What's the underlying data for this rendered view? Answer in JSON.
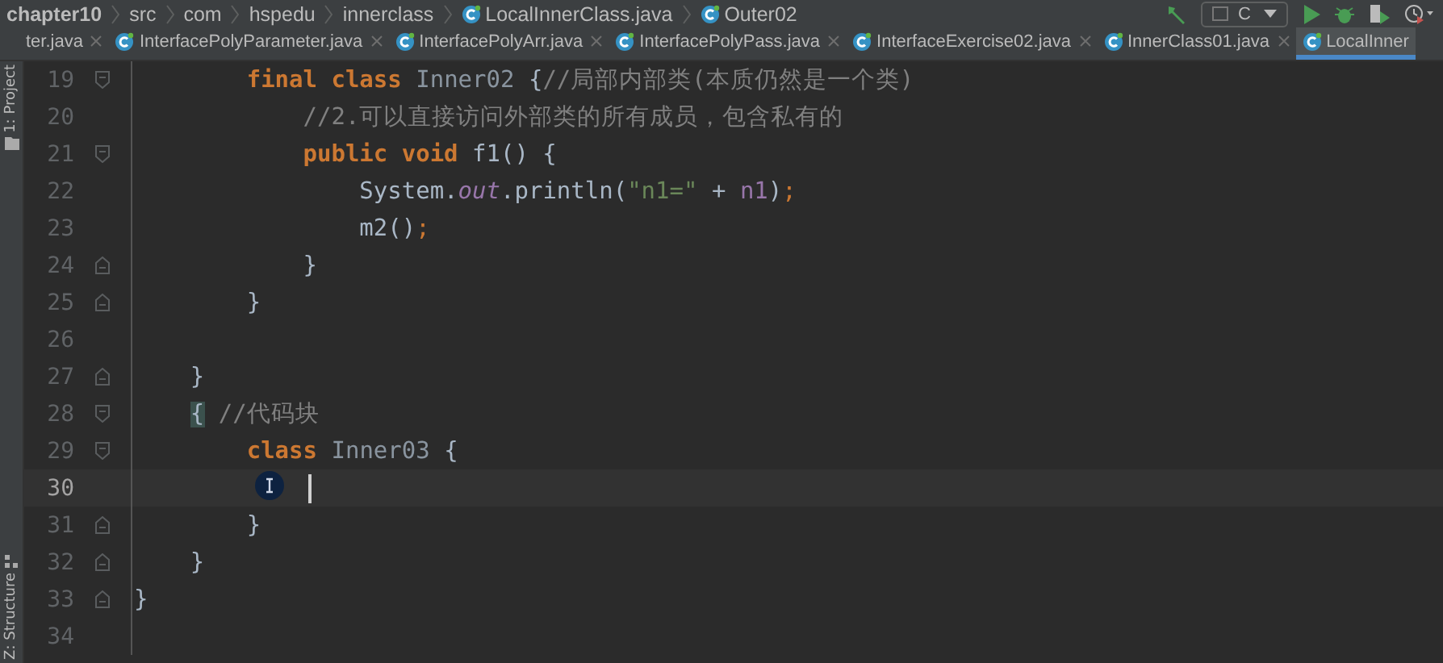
{
  "breadcrumbs": [
    {
      "label": "chapter10",
      "kind": "project"
    },
    {
      "label": "src",
      "kind": "folder"
    },
    {
      "label": "com",
      "kind": "folder"
    },
    {
      "label": "hspedu",
      "kind": "folder"
    },
    {
      "label": "innerclass",
      "kind": "folder"
    },
    {
      "label": "LocalInnerClass.java",
      "kind": "class"
    },
    {
      "label": "Outer02",
      "kind": "class"
    }
  ],
  "toolbar": {
    "config": "C"
  },
  "tabs": [
    {
      "label": "ter.java",
      "selected": false
    },
    {
      "label": "InterfacePolyParameter.java",
      "selected": false
    },
    {
      "label": "InterfacePolyArr.java",
      "selected": false
    },
    {
      "label": "InterfacePolyPass.java",
      "selected": false
    },
    {
      "label": "InterfaceExercise02.java",
      "selected": false
    },
    {
      "label": "InnerClass01.java",
      "selected": false
    },
    {
      "label": "LocalInner",
      "selected": true
    }
  ],
  "side_tools": [
    {
      "label": "1: Project",
      "kind": "project"
    },
    {
      "label": "Z: Structure",
      "kind": "structure"
    }
  ],
  "lines": [
    {
      "number": "19",
      "kind": "fold-start",
      "current": false,
      "tokens": [
        {
          "kind": "keyword",
          "text": "        final class"
        },
        {
          "kind": "unused",
          "text": " Inner02 "
        },
        {
          "kind": "text",
          "text": "{"
        },
        {
          "kind": "comment",
          "text": "//局部内部类(本质仍然是一个类)"
        }
      ]
    },
    {
      "number": "20",
      "kind": "plain",
      "current": false,
      "tokens": [
        {
          "kind": "comment",
          "text": "            //2.可以直接访问外部类的所有成员，包含私有的"
        }
      ]
    },
    {
      "number": "21",
      "kind": "fold-start",
      "current": false,
      "tokens": [
        {
          "kind": "keyword",
          "text": "            public void"
        },
        {
          "kind": "text",
          "text": " f1() {"
        }
      ]
    },
    {
      "number": "22",
      "kind": "plain",
      "current": false,
      "tokens": [
        {
          "kind": "text",
          "text": "                System."
        },
        {
          "kind": "static",
          "text": "out"
        },
        {
          "kind": "text",
          "text": ".println("
        },
        {
          "kind": "string",
          "text": "\"n1=\""
        },
        {
          "kind": "text",
          "text": " + "
        },
        {
          "kind": "field",
          "text": "n1"
        },
        {
          "kind": "text",
          "text": ")"
        },
        {
          "kind": "punct",
          "text": ";"
        }
      ]
    },
    {
      "number": "23",
      "kind": "plain",
      "current": false,
      "tokens": [
        {
          "kind": "text",
          "text": "                m2()"
        },
        {
          "kind": "punct",
          "text": ";"
        }
      ]
    },
    {
      "number": "24",
      "kind": "fold-end",
      "current": false,
      "tokens": [
        {
          "kind": "text",
          "text": "            }"
        }
      ]
    },
    {
      "number": "25",
      "kind": "fold-end",
      "current": false,
      "tokens": [
        {
          "kind": "text",
          "text": "        }"
        }
      ]
    },
    {
      "number": "26",
      "kind": "plain",
      "current": false
    },
    {
      "number": "27",
      "kind": "fold-end",
      "current": false,
      "tokens": [
        {
          "kind": "text",
          "text": "    }"
        }
      ]
    },
    {
      "number": "28",
      "kind": "fold-start",
      "current": false,
      "tokens": [
        {
          "kind": "matched",
          "text": "    {"
        },
        {
          "kind": "comment",
          "text": " //代码块"
        }
      ]
    },
    {
      "number": "29",
      "kind": "fold-start",
      "current": false,
      "tokens": [
        {
          "kind": "keyword",
          "text": "        class"
        },
        {
          "kind": "unused",
          "text": " Inner03 "
        },
        {
          "kind": "text",
          "text": "{"
        }
      ]
    },
    {
      "number": "30",
      "kind": "plain",
      "current": true
    },
    {
      "number": "31",
      "kind": "fold-end",
      "current": false,
      "tokens": [
        {
          "kind": "text",
          "text": "        }"
        }
      ]
    },
    {
      "number": "32",
      "kind": "fold-end",
      "current": false,
      "tokens": [
        {
          "kind": "text",
          "text": "    }"
        }
      ]
    },
    {
      "number": "33",
      "kind": "fold-end",
      "current": false,
      "tokens": [
        {
          "kind": "text",
          "text": "}"
        }
      ]
    },
    {
      "number": "34",
      "kind": "plain",
      "current": false
    }
  ]
}
